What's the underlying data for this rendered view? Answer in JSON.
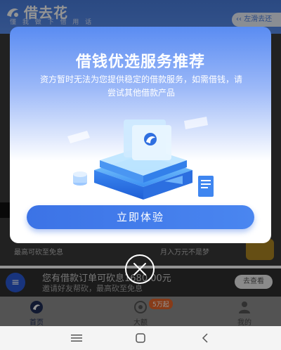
{
  "app": {
    "logo_text": "借去花",
    "slogan": "懂 我 做 下 借 用 话",
    "scroll_hint": "左滑去还"
  },
  "features": {
    "left": "最高可砍至免息",
    "right": "月入万元不是梦"
  },
  "notification": {
    "title": "您有借款订单可砍息1680.00元",
    "subtitle": "邀请好友帮砍，最高砍至免息",
    "button": "去查看"
  },
  "tabbar": {
    "items": [
      {
        "label": "首页",
        "icon": "home-icon"
      },
      {
        "label": "大额",
        "icon": "large-loan-icon"
      },
      {
        "label": "我的",
        "icon": "profile-icon"
      }
    ],
    "badge": "5万起"
  },
  "modal": {
    "title": "借钱优选服务推荐",
    "description": "资方暂时无法为您提供稳定的借款服务，如需借钱，请尝试其他借款产品",
    "cta_label": "立即体验"
  },
  "colors": {
    "brand_blue": "#3c73e6",
    "cta_gradient_end": "#4a86f0",
    "badge_orange": "#e8662a"
  }
}
